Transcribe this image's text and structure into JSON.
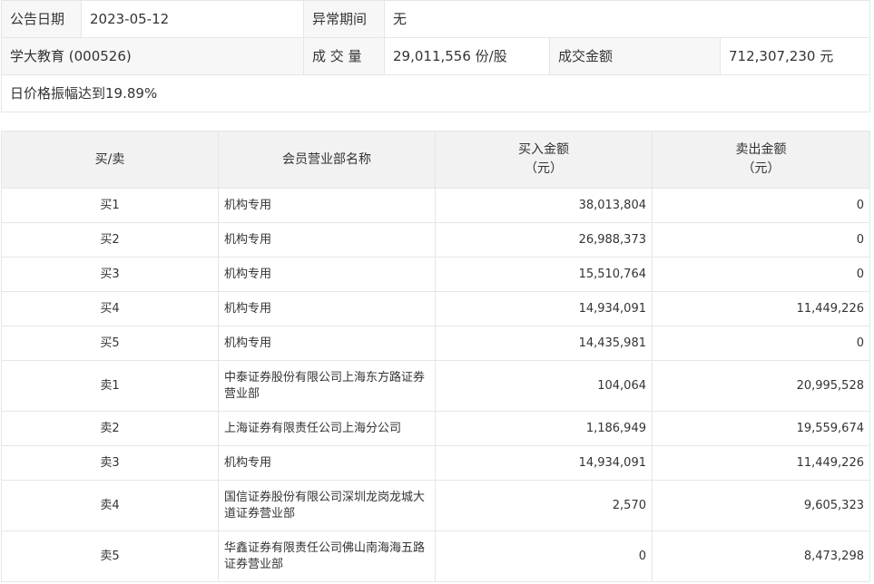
{
  "summary": {
    "announce_date_label": "公告日期",
    "announce_date": "2023-05-12",
    "abnormal_period_label": "异常期间",
    "abnormal_period": "无",
    "stock_name": "学大教育 (000526)",
    "volume_label": "成 交 量",
    "volume": "29,011,556 份/股",
    "turnover_label": "成交金额",
    "turnover": "712,307,230 元",
    "reason": "日价格振幅达到19.89%"
  },
  "detail": {
    "headers": {
      "side": "买/卖",
      "branch": "会员营业部名称",
      "buy_amount": "买入金额",
      "buy_unit": "（元）",
      "sell_amount": "卖出金额",
      "sell_unit": "（元）"
    },
    "rows": [
      {
        "side": "买1",
        "branch": "机构专用",
        "buy": "38,013,804",
        "sell": "0"
      },
      {
        "side": "买2",
        "branch": "机构专用",
        "buy": "26,988,373",
        "sell": "0"
      },
      {
        "side": "买3",
        "branch": "机构专用",
        "buy": "15,510,764",
        "sell": "0"
      },
      {
        "side": "买4",
        "branch": "机构专用",
        "buy": "14,934,091",
        "sell": "11,449,226"
      },
      {
        "side": "买5",
        "branch": "机构专用",
        "buy": "14,435,981",
        "sell": "0"
      },
      {
        "side": "卖1",
        "branch": "中泰证券股份有限公司上海东方路证券营业部",
        "buy": "104,064",
        "sell": "20,995,528"
      },
      {
        "side": "卖2",
        "branch": "上海证券有限责任公司上海分公司",
        "buy": "1,186,949",
        "sell": "19,559,674"
      },
      {
        "side": "卖3",
        "branch": "机构专用",
        "buy": "14,934,091",
        "sell": "11,449,226"
      },
      {
        "side": "卖4",
        "branch": "国信证券股份有限公司深圳龙岗龙城大道证券营业部",
        "buy": "2,570",
        "sell": "9,605,323"
      },
      {
        "side": "卖5",
        "branch": "华鑫证券有限责任公司佛山南海海五路证券营业部",
        "buy": "0",
        "sell": "8,473,298"
      }
    ]
  }
}
